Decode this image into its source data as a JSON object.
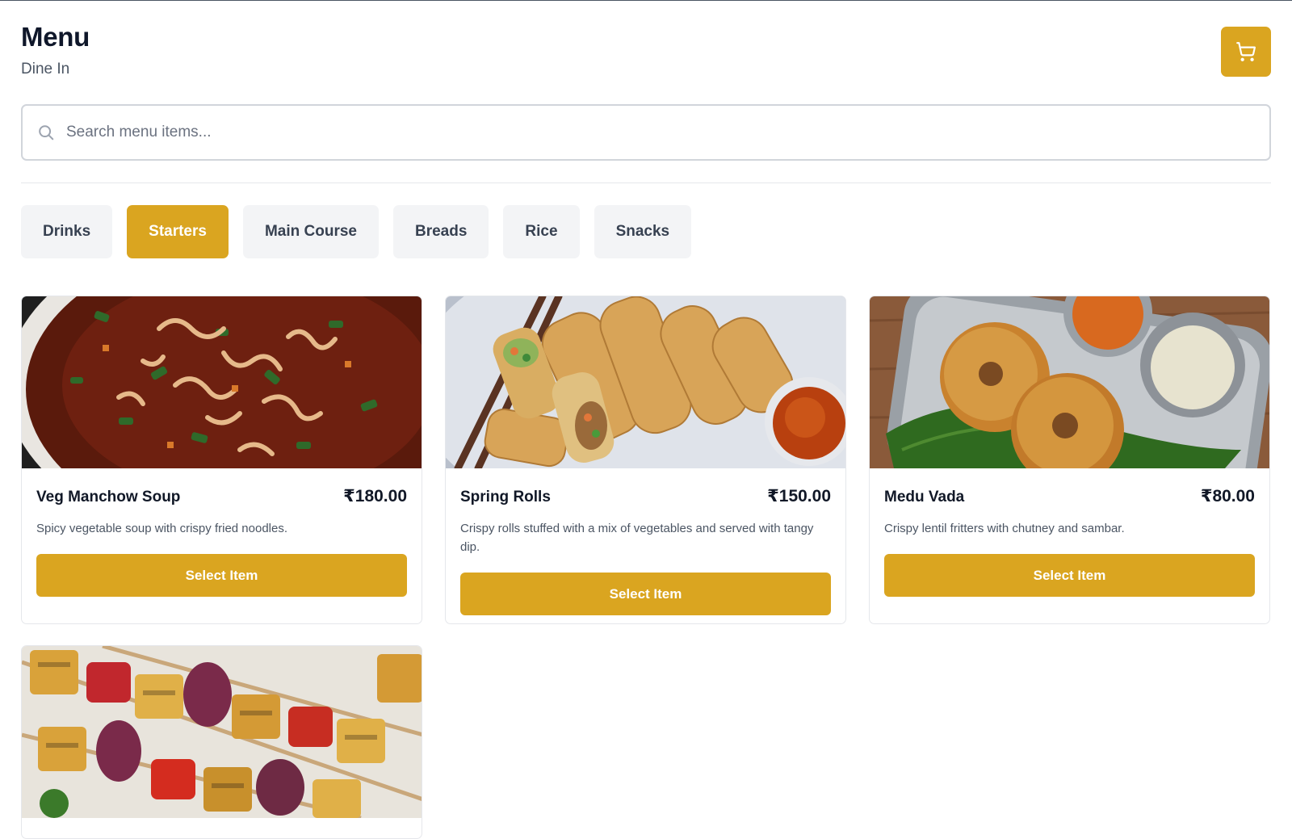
{
  "header": {
    "title": "Menu",
    "subtitle": "Dine In"
  },
  "cart": {
    "icon": "cart-icon"
  },
  "search": {
    "placeholder": "Search menu items...",
    "value": ""
  },
  "categories": [
    {
      "label": "Drinks",
      "active": false
    },
    {
      "label": "Starters",
      "active": true
    },
    {
      "label": "Main Course",
      "active": false
    },
    {
      "label": "Breads",
      "active": false
    },
    {
      "label": "Rice",
      "active": false
    },
    {
      "label": "Snacks",
      "active": false
    }
  ],
  "items": [
    {
      "name": "Veg Manchow Soup",
      "price": "₹180.00",
      "description": "Spicy vegetable soup with crispy fried noodles.",
      "button": "Select Item"
    },
    {
      "name": "Spring Rolls",
      "price": "₹150.00",
      "description": "Crispy rolls stuffed with a mix of vegetables and served with tangy dip.",
      "button": "Select Item"
    },
    {
      "name": "Medu Vada",
      "price": "₹80.00",
      "description": "Crispy lentil fritters with chutney and sambar.",
      "button": "Select Item"
    },
    {
      "name": "",
      "price": "",
      "description": "",
      "button": ""
    }
  ],
  "colors": {
    "accent": "#daa520",
    "tab_bg": "#f3f4f6",
    "text": "#111827"
  }
}
